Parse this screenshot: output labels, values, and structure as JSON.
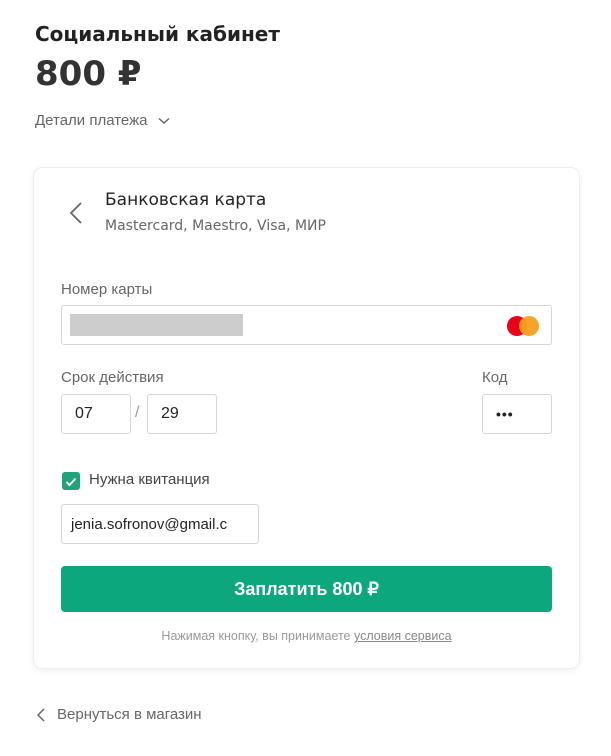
{
  "merchant_name": "Социальный кабинет",
  "amount": "800 ₽",
  "payment_details_label": "Детали платежа",
  "method": {
    "title": "Банковская карта",
    "subtitle": "Mastercard, Maestro, Visa, МИР"
  },
  "form": {
    "card_number_label": "Номер карты",
    "expiry_label": "Срок действия",
    "expiry_month": "07",
    "expiry_separator": "/",
    "expiry_year": "29",
    "cvc_label": "Код",
    "cvc_value": "•••",
    "receipt_label": "Нужна квитанция",
    "receipt_checked": true,
    "email_value": "jenia.sofronov@gmail.c"
  },
  "pay_button_label": "Заплатить 800 ₽",
  "terms": {
    "text": "Нажимая кнопку, вы принимаете ",
    "link": "условия сервиса"
  },
  "back_to_shop_label": "Вернуться в магазин",
  "icons": {
    "payment_details": "chevron-down-icon",
    "method_back": "chevron-left-icon",
    "card_brand": "mastercard-icon",
    "checkbox": "check-icon",
    "back_to_shop": "chevron-left-icon"
  },
  "colors": {
    "accent": "#0da77e",
    "checkbox": "#1fa37a",
    "mastercard_red": "#eb001b",
    "mastercard_orange": "#f79e1b"
  }
}
